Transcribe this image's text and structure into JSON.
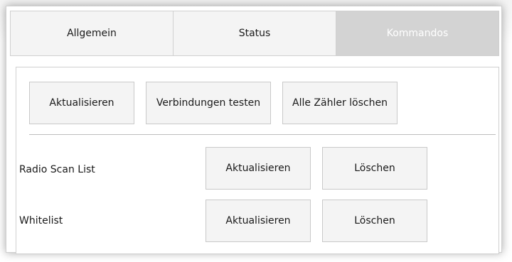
{
  "tabs": [
    {
      "label": "Allgemein",
      "active": false
    },
    {
      "label": "Status",
      "active": false
    },
    {
      "label": "Kommandos",
      "active": true
    }
  ],
  "commands": {
    "refresh_label": "Aktualisieren",
    "test_connections_label": "Verbindungen testen",
    "clear_counters_label": "Alle Zähler löschen"
  },
  "rows": [
    {
      "label": "Radio Scan List",
      "refresh_label": "Aktualisieren",
      "delete_label": "Löschen"
    },
    {
      "label": "Whitelist",
      "refresh_label": "Aktualisieren",
      "delete_label": "Löschen"
    }
  ],
  "colors": {
    "active_tab_bg": "#d3d3d3",
    "tab_bg": "#f4f4f4",
    "button_bg": "#f4f4f4",
    "border": "#c9c9c9"
  }
}
